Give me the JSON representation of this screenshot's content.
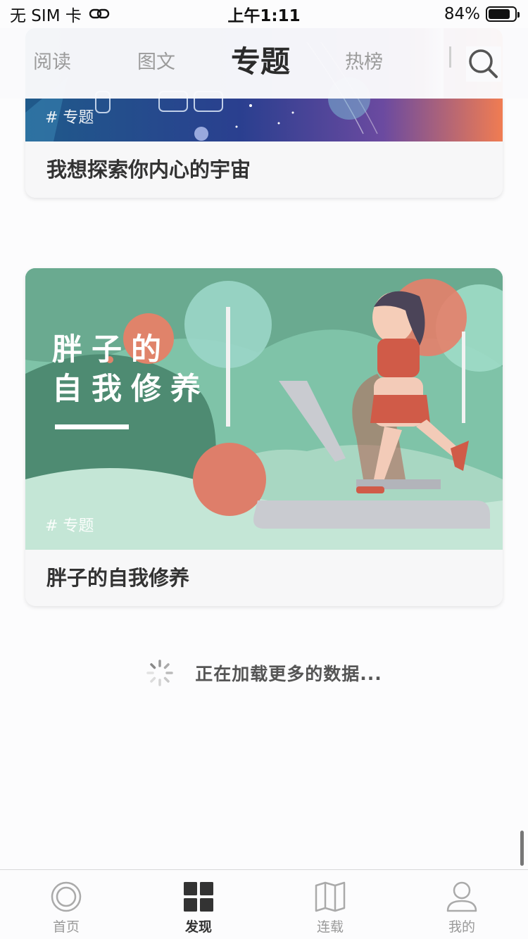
{
  "status_bar": {
    "carrier": "无 SIM 卡",
    "time": "上午1:11",
    "battery": "84%",
    "battery_level": 0.84
  },
  "top_nav": {
    "tabs": [
      {
        "label": "阅读"
      },
      {
        "label": "图文"
      },
      {
        "label": "专题"
      },
      {
        "label": "热榜"
      }
    ],
    "active_tab": "专题"
  },
  "cards": [
    {
      "tag": "# 专题",
      "title": "我想探索你内心的宇宙"
    },
    {
      "tag": "# 专题",
      "title": "胖子的自我修养",
      "poster_text": [
        "胖子的",
        "自我修养"
      ]
    }
  ],
  "loading": {
    "text": "正在加载更多的数据..."
  },
  "tab_bar": {
    "items": [
      {
        "label": "首页",
        "icon": "circle-home-icon"
      },
      {
        "label": "发现",
        "icon": "grid-icon"
      },
      {
        "label": "连载",
        "icon": "book-icon"
      },
      {
        "label": "我的",
        "icon": "user-icon"
      }
    ],
    "active": "发现"
  },
  "colors": {
    "card1_gradient": [
      "#1f5a8a",
      "#2a3f8f",
      "#6b4aa0",
      "#f07c52"
    ],
    "card2_background": "#7fc3a8",
    "accent_salmon": "#de7e6a"
  }
}
